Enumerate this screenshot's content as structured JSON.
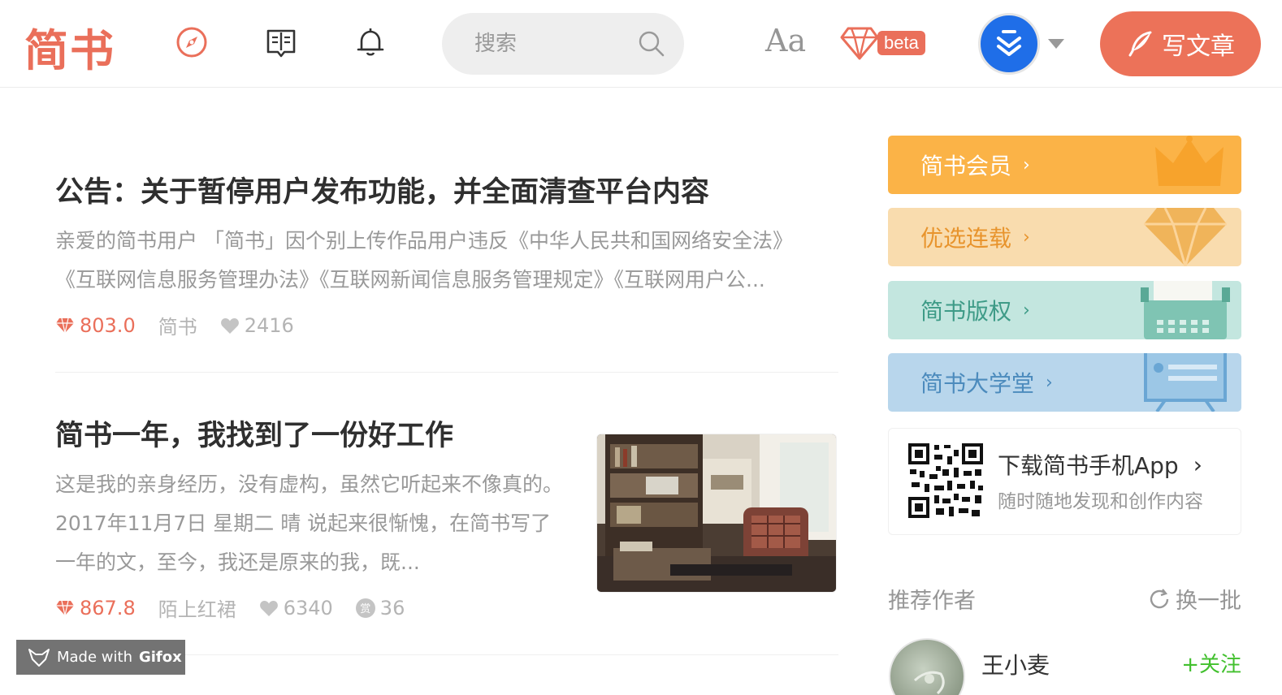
{
  "header": {
    "logo": "简书",
    "search_placeholder": "搜索",
    "font_toggle": "Aa",
    "beta_label": "beta",
    "write_label": "写文章",
    "accent_color": "#ea6f5a",
    "icons": [
      "compass-icon",
      "book-icon",
      "bell-icon",
      "search-icon",
      "diamond-icon",
      "feather-icon"
    ]
  },
  "articles": [
    {
      "title": "公告：关于暂停用户发布功能，并全面清查平台内容",
      "abstract": "亲爱的简书用户 「简书」因个别上传作品用户违反《中华人民共和国网络安全法》《互联网信息服务管理办法》《互联网新闻信息服务管理规定》《互联网用户公...",
      "diamond": "803.0",
      "author": "简书",
      "likes": "2416"
    },
    {
      "title": "简书一年，我找到了一份好工作",
      "abstract": "这是我的亲身经历，没有虚构，虽然它听起来不像真的。 2017年11月7日 星期二 晴 说起来很惭愧，在简书写了一年的文，至今，我还是原来的我，既...",
      "diamond": "867.8",
      "author": "陌上红裙",
      "likes": "6340",
      "reward_badge": "赏",
      "rewards": "36"
    }
  ],
  "sidebar": {
    "banners": [
      {
        "label": "简书会员",
        "bg": "#fbb347",
        "color": "#ffffff"
      },
      {
        "label": "优选连载",
        "bg": "#f9dcae",
        "color": "#e8942d"
      },
      {
        "label": "简书版权",
        "bg": "#c3e6df",
        "color": "#3e9b87"
      },
      {
        "label": "简书大学堂",
        "bg": "#b8d6ec",
        "color": "#4c8bbd"
      }
    ],
    "app": {
      "title": "下载简书手机App",
      "subtitle": "随时随地发现和创作内容"
    },
    "recommend": {
      "title": "推荐作者",
      "refresh": "换一批"
    },
    "authors": [
      {
        "name": "王小麦",
        "follow": "+关注"
      }
    ]
  },
  "watermark": {
    "prefix": "Made with",
    "brand": "Gifox"
  }
}
